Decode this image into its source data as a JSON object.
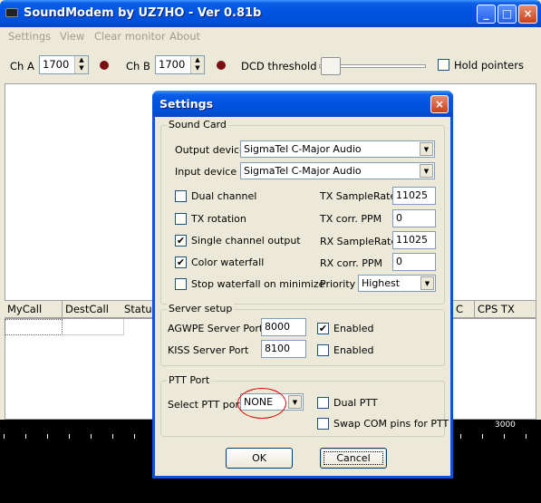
{
  "window": {
    "title": "SoundModem by UZ7HO - Ver 0.81b",
    "controls": {
      "minimize": "_",
      "maximize": "□",
      "close": "×"
    }
  },
  "menu": [
    "Settings",
    "View",
    "Clear monitor",
    "About"
  ],
  "toolbar": {
    "cha_label": "Ch A",
    "cha_value": "1700",
    "chb_label": "Ch B",
    "chb_value": "1700",
    "dcd_label": "DCD threshold",
    "hold_pointers_label": "Hold pointers",
    "hold_pointers_checked": false
  },
  "grid": {
    "columns": [
      "MyCall",
      "DestCall",
      "Status",
      "C",
      "CPS TX"
    ]
  },
  "waterfall": {
    "scale_label": "3000"
  },
  "dialog": {
    "title": "Settings",
    "close": "×",
    "sound_card": {
      "title": "Sound Card",
      "output_label": "Output device",
      "output_value": "SigmaTel C-Major Audio",
      "input_label": "Input device",
      "input_value": "SigmaTel C-Major Audio",
      "checks": [
        {
          "label": "Dual channel",
          "checked": false
        },
        {
          "label": "TX rotation",
          "checked": false
        },
        {
          "label": "Single channel output",
          "checked": true
        },
        {
          "label": "Color waterfall",
          "checked": true
        },
        {
          "label": "Stop waterfall on minimize",
          "checked": false
        }
      ],
      "tx_samplerate_label": "TX SampleRate",
      "tx_samplerate": "11025",
      "tx_ppm_label": "TX corr. PPM",
      "tx_ppm": "0",
      "rx_samplerate_label": "RX SampleRate",
      "rx_samplerate": "11025",
      "rx_ppm_label": "RX corr. PPM",
      "rx_ppm": "0",
      "priority_label": "Priority",
      "priority_value": "Highest"
    },
    "server": {
      "title": "Server setup",
      "agwpe_label": "AGWPE Server Port",
      "agwpe_port": "8000",
      "agwpe_enabled_label": "Enabled",
      "agwpe_enabled": true,
      "kiss_label": "KISS Server Port",
      "kiss_port": "8100",
      "kiss_enabled_label": "Enabled",
      "kiss_enabled": false
    },
    "ptt": {
      "title": "PTT Port",
      "select_label": "Select PTT port",
      "select_value": "NONE",
      "dual_ptt_label": "Dual PTT",
      "dual_ptt": false,
      "swap_label": "Swap COM pins for PTT",
      "swap": false
    },
    "ok_label": "OK",
    "cancel_label": "Cancel"
  },
  "colors": {
    "accent": "#0054e3",
    "highlight_circle": "#e00000"
  }
}
